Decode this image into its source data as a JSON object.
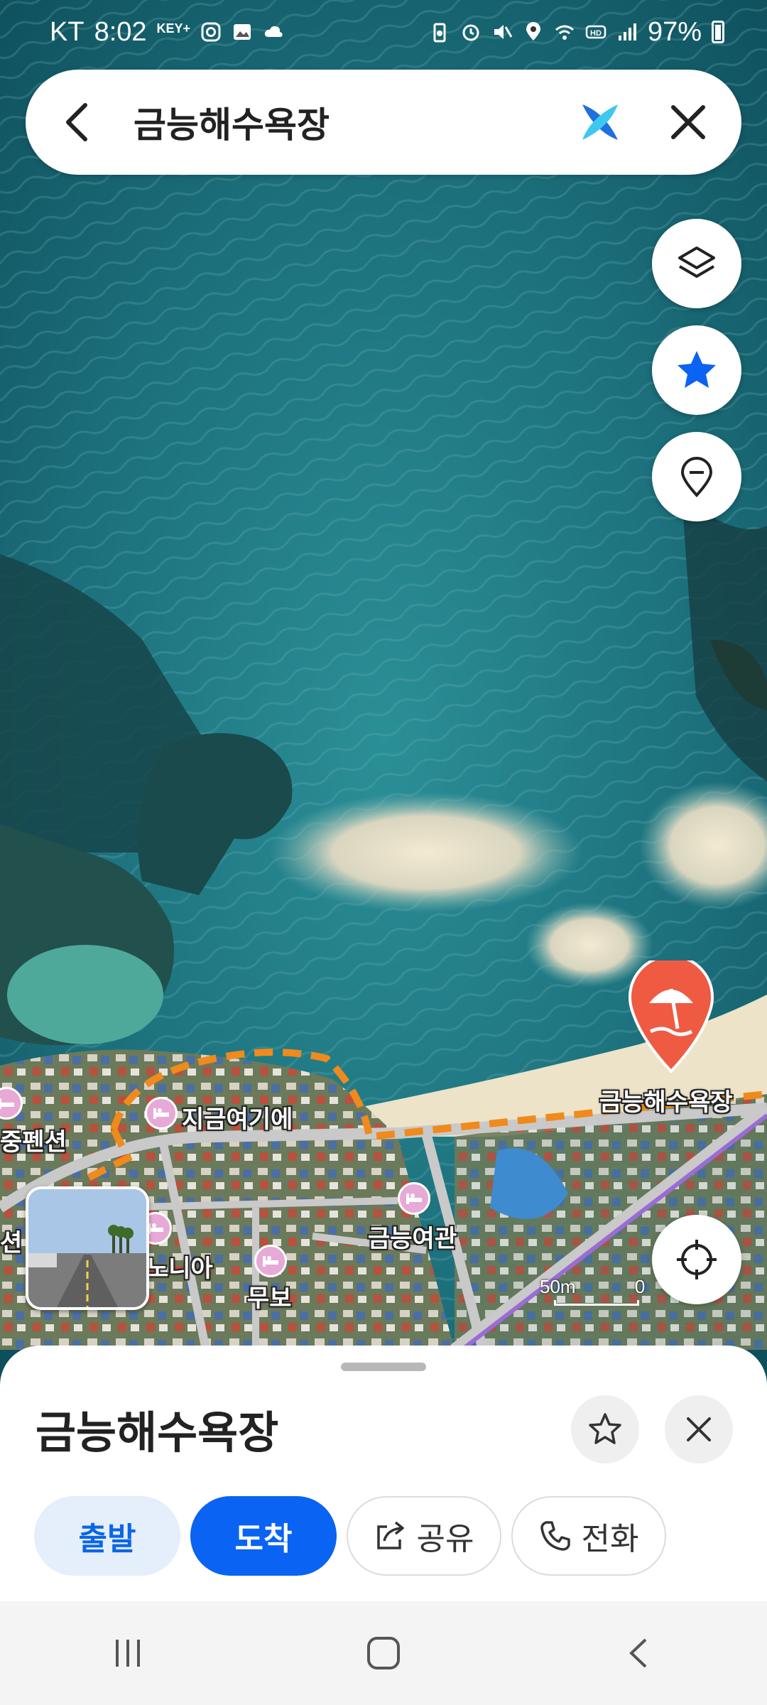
{
  "status_bar": {
    "carrier": "KT",
    "time": "8:02",
    "key_badge": "KEY+",
    "battery": "97%"
  },
  "search": {
    "query": "금능해수욕장"
  },
  "map": {
    "place_pin_label": "금능해수욕장",
    "labels": [
      {
        "text": "지금여기에"
      },
      {
        "text": "중펜션"
      },
      {
        "text": "금능여관"
      },
      {
        "text": "노니아"
      },
      {
        "text": "무보"
      },
      {
        "text": "션"
      }
    ],
    "scale": {
      "distance": "50m",
      "zero": "0"
    }
  },
  "sheet": {
    "title": "금능해수욕장",
    "buttons": {
      "depart": "출발",
      "arrive": "도착",
      "share": "공유",
      "call": "전화"
    }
  },
  "colors": {
    "primary": "#0a63f2",
    "pin": "#ef5a43",
    "route_orange": "#f08a1c",
    "poi_pink": "#e7a9d6"
  }
}
